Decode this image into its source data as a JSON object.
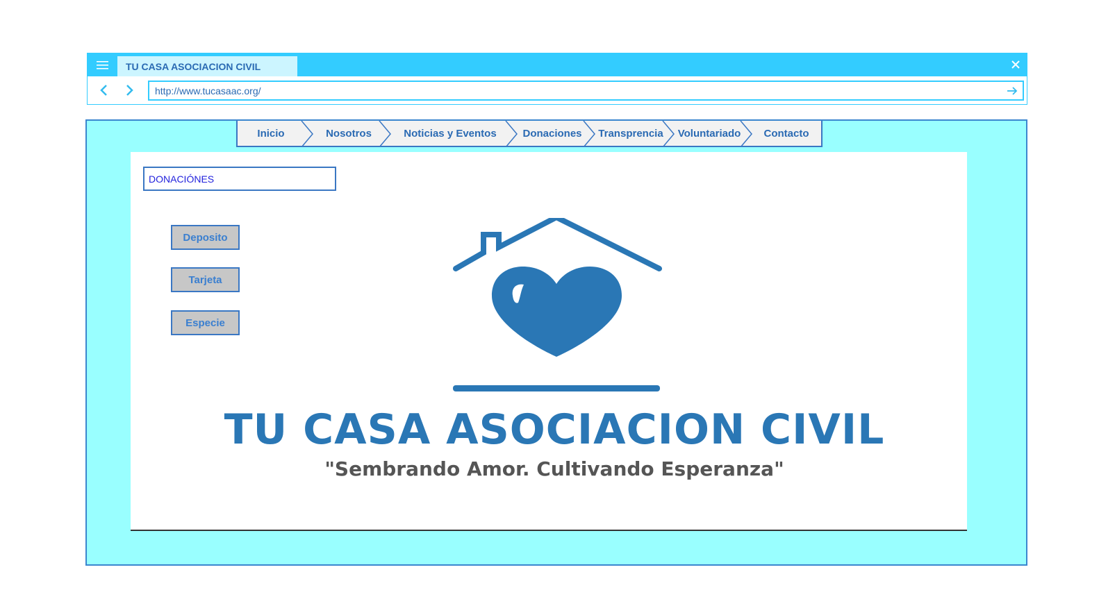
{
  "browser": {
    "tab_title": "TU CASA ASOCIACION CIVIL",
    "url": "http://www.tucasaac.org/"
  },
  "nav": {
    "items": [
      {
        "label": "Inicio"
      },
      {
        "label": "Nosotros"
      },
      {
        "label": "Noticias y Eventos"
      },
      {
        "label": "Donaciones"
      },
      {
        "label": "Transprencia"
      },
      {
        "label": "Voluntariado"
      },
      {
        "label": "Contacto"
      }
    ]
  },
  "main": {
    "section_title": "DONACIÓNES",
    "buttons": [
      {
        "label": "Deposito"
      },
      {
        "label": "Tarjeta"
      },
      {
        "label": "Especie"
      }
    ],
    "logo": {
      "name": "TU CASA ASOCIACION CIVIL",
      "slogan": "\"Sembrando Amor. Cultivando Esperanza\""
    }
  },
  "colors": {
    "chrome": "#33ccff",
    "page_background": "#99ffff",
    "brand_blue": "#2a77b5",
    "nav_text": "#2a6ab3"
  },
  "icons": [
    "menu-icon",
    "close-icon",
    "back-arrow-icon",
    "forward-arrow-icon",
    "go-arrow-icon",
    "house-heart-icon"
  ]
}
